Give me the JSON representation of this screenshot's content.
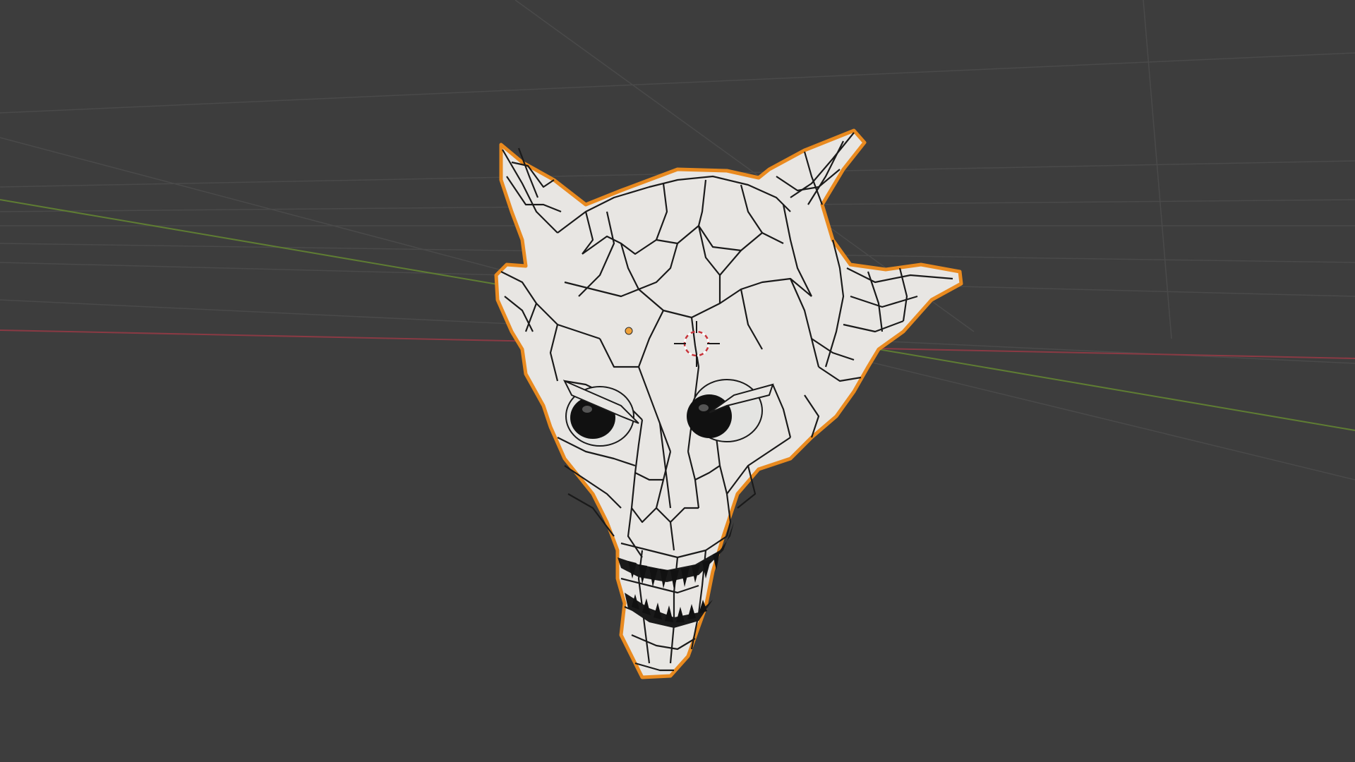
{
  "app": "Blender",
  "viewport": {
    "mode": "object-mode",
    "shading": "solid",
    "overlay": "wireframe",
    "selected_object": "demon-head-mesh",
    "colors": {
      "background": "#3d3d3d",
      "grid_line": "#4a4a4a",
      "x_axis": "#8a3a44",
      "y_axis": "#5f7d33",
      "selection_outline": "#e98a1f",
      "mesh_fill": "#e8e6e3",
      "wire": "#1a1a1a",
      "eye": "#111111",
      "origin_dot": "#f0a23a",
      "cursor_ring": "#c8343a"
    },
    "icons": [
      "3d-cursor-icon",
      "object-origin-icon"
    ]
  }
}
